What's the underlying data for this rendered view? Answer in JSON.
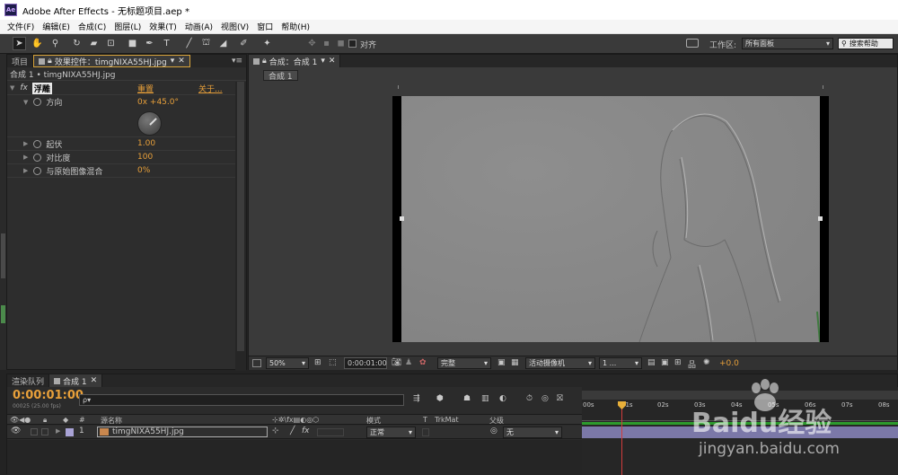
{
  "window": {
    "title": "Adobe After Effects - 无标题项目.aep *",
    "logo": "Ae"
  },
  "menu": [
    "文件(F)",
    "编辑(E)",
    "合成(C)",
    "图层(L)",
    "效果(T)",
    "动画(A)",
    "视图(V)",
    "窗口",
    "帮助(H)"
  ],
  "toolbar": {
    "snap_label": "对齐",
    "workspace_label": "工作区:",
    "workspace_value": "所有面板",
    "search_label": "搜索帮助"
  },
  "project_panel": {
    "tab_project": "项目",
    "tab_effects": "效果控件：timgNIXA55HJ.jpg",
    "subtitle": "合成 1 • timgNIXA55HJ.jpg"
  },
  "effect": {
    "name": "浮雕",
    "reset": "重置",
    "about": "关于...",
    "props": [
      {
        "label": "方向",
        "value": "0x +45.0°"
      },
      {
        "label": "起伏",
        "value": "1.00"
      },
      {
        "label": "对比度",
        "value": "100"
      },
      {
        "label": "与原始图像混合",
        "value": "0%"
      }
    ]
  },
  "comp_panel": {
    "tab": "合成：合成 1",
    "breadcrumb": "合成 1"
  },
  "viewer_bar": {
    "zoom": "50%",
    "timecode": "0:00:01:00",
    "quality": "完整",
    "camera": "活动摄像机",
    "views": "1 ...",
    "exposure": "+0.0"
  },
  "timeline": {
    "tab_render": "渲染队列",
    "tab_comp": "合成 1",
    "timecode": "0:00:01:00",
    "fps": "00025 (25.00 fps)",
    "search_placeholder": "ρ▾",
    "columns": {
      "source_name": "源名称",
      "mode": "模式",
      "t": "T",
      "trkmat": "TrkMat",
      "parent": "父级"
    },
    "ruler": [
      "00s",
      "01s",
      "02s",
      "03s",
      "04s",
      "05s",
      "06s",
      "07s",
      "08s"
    ],
    "playhead_fraction": 0.125,
    "layer": {
      "number": "1",
      "name": "timgNIXA55HJ.jpg",
      "mode": "正常",
      "parent": "无"
    }
  },
  "watermark": {
    "brand": "Baidu经验",
    "url": "jingyan.baidu.com"
  }
}
